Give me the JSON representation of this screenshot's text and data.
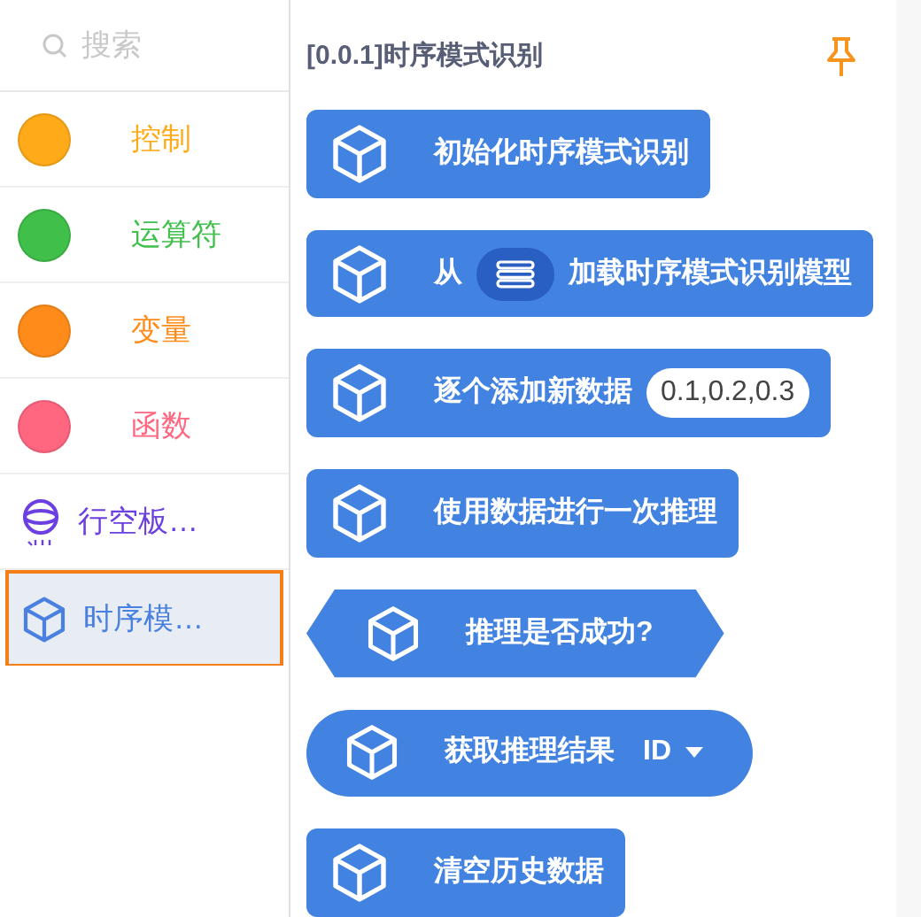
{
  "search": {
    "placeholder": "搜索"
  },
  "categories": [
    {
      "label": "控制",
      "kind": "dot",
      "color": "#ffab19",
      "selected": false
    },
    {
      "label": "运算符",
      "kind": "dot",
      "color": "#40bf4a",
      "selected": false
    },
    {
      "label": "变量",
      "kind": "dot",
      "color": "#ff8c1a",
      "selected": false
    },
    {
      "label": "函数",
      "kind": "dot",
      "color": "#ff6680",
      "selected": false
    },
    {
      "label": "行空板…",
      "kind": "board",
      "color": "#6b3fe0",
      "selected": false
    },
    {
      "label": "时序模…",
      "kind": "cube",
      "color": "#4a80e0",
      "selected": true
    }
  ],
  "palette": {
    "title": "[0.0.1]时序模式识别",
    "blocks": [
      {
        "kind": "stack",
        "parts": [
          {
            "kind": "text",
            "text": "初始化时序模式识别"
          }
        ]
      },
      {
        "kind": "stack",
        "parts": [
          {
            "kind": "text",
            "text": "从"
          },
          {
            "kind": "menu"
          },
          {
            "kind": "text",
            "text": "加载时序模式识别模型"
          }
        ]
      },
      {
        "kind": "stack",
        "parts": [
          {
            "kind": "text",
            "text": "逐个添加新数据"
          },
          {
            "kind": "value",
            "text": "0.1,0.2,0.3"
          }
        ]
      },
      {
        "kind": "stack",
        "parts": [
          {
            "kind": "text",
            "text": "使用数据进行一次推理"
          }
        ]
      },
      {
        "kind": "boolean",
        "parts": [
          {
            "kind": "text",
            "text": "推理是否成功?"
          }
        ]
      },
      {
        "kind": "reporter",
        "parts": [
          {
            "kind": "text",
            "text": "获取推理结果"
          },
          {
            "kind": "dropdown",
            "text": "ID"
          }
        ]
      },
      {
        "kind": "stack",
        "parts": [
          {
            "kind": "text",
            "text": "清空历史数据"
          }
        ]
      }
    ]
  }
}
